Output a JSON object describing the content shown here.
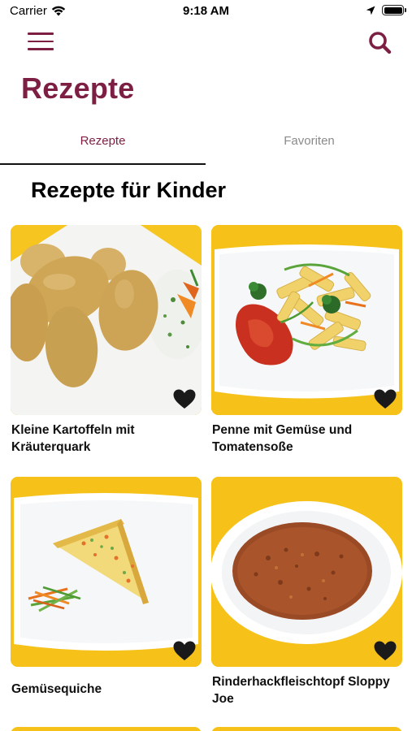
{
  "status_bar": {
    "carrier": "Carrier",
    "time": "9:18 AM"
  },
  "nav": {
    "menu_icon": "hamburger-menu-icon",
    "search_icon": "search-icon"
  },
  "page_title": "Rezepte",
  "tabs": [
    {
      "label": "Rezepte",
      "active": true
    },
    {
      "label": "Favoriten",
      "active": false
    }
  ],
  "section_title": "Rezepte für Kinder",
  "recipes": [
    {
      "name": "Kleine Kartoffeln mit Kräuterquark",
      "favorite_icon": "heart-icon"
    },
    {
      "name": "Penne mit Gemüse und Tomatensoße",
      "favorite_icon": "heart-icon"
    },
    {
      "name": "Gemüsequiche",
      "favorite_icon": "heart-icon"
    },
    {
      "name": "Rinderhackfleischtopf Sloppy Joe",
      "favorite_icon": "heart-icon"
    }
  ],
  "colors": {
    "brand": "#7d1e43",
    "photo_background": "#f6c21a",
    "inactive_tab": "#8a8a8a"
  }
}
